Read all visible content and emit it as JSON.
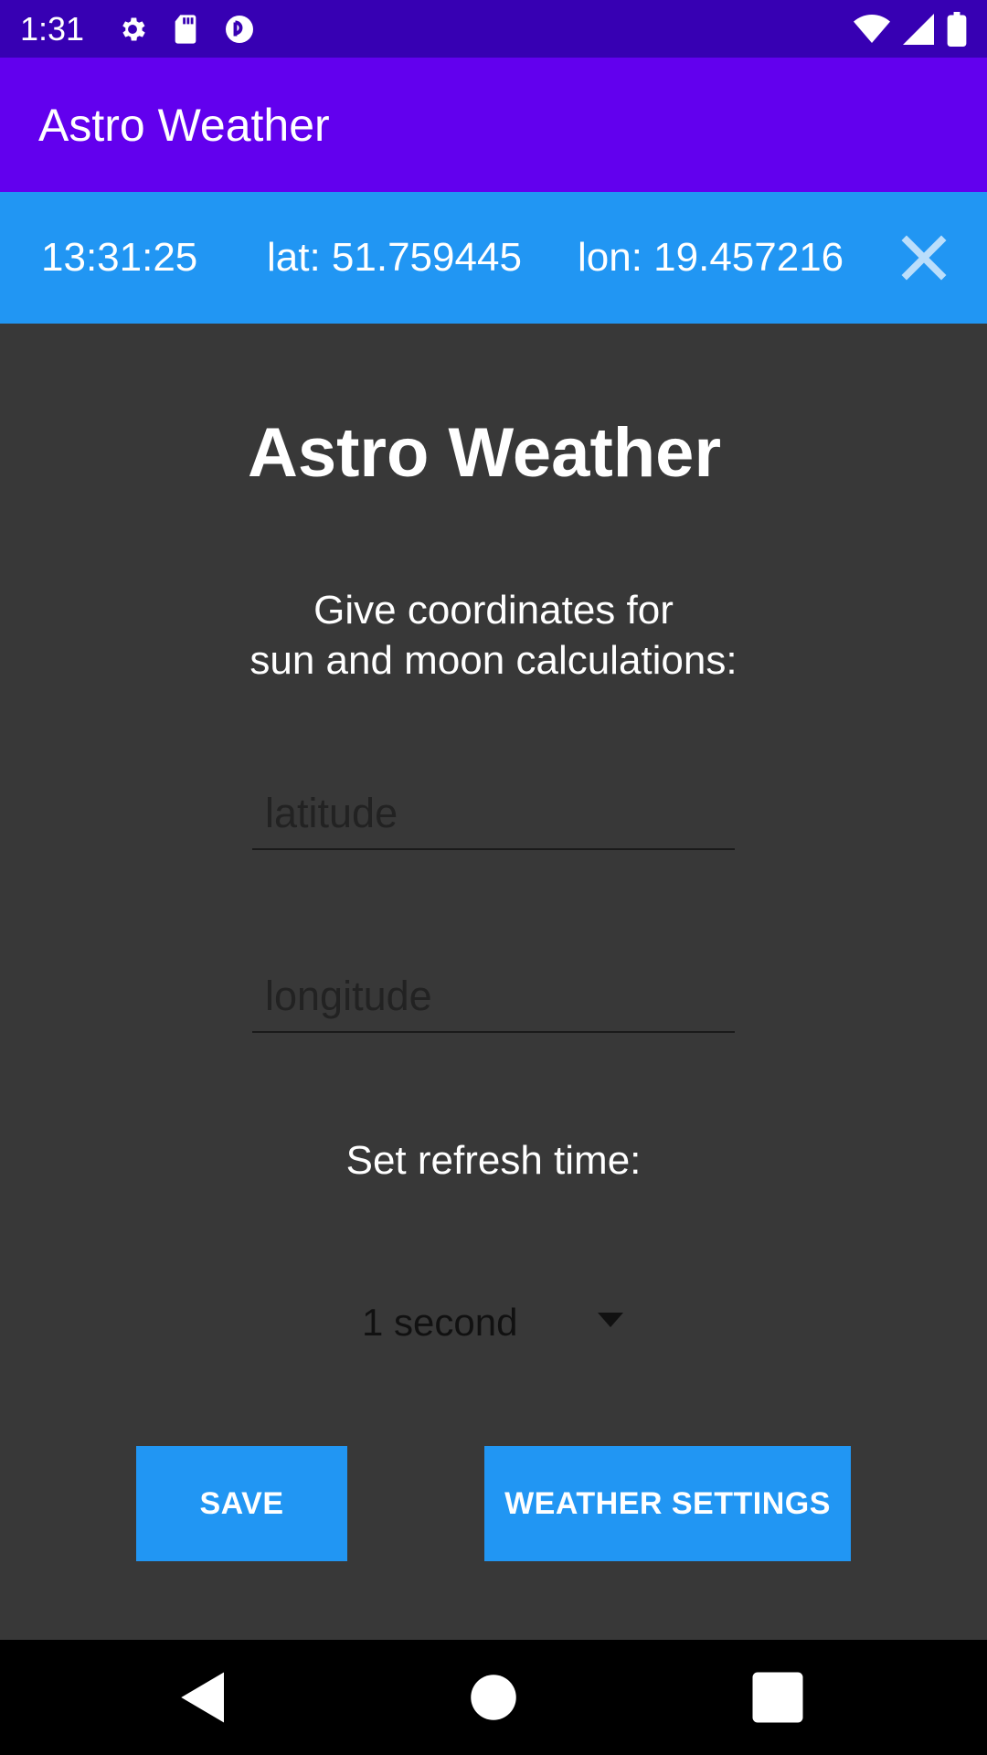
{
  "status_bar": {
    "time": "1:31",
    "icons_left": [
      "settings-icon",
      "sd-card-icon",
      "app-notification-icon"
    ],
    "icons_right": [
      "wifi-icon",
      "signal-icon",
      "battery-icon"
    ]
  },
  "app_bar": {
    "title": "Astro Weather"
  },
  "info_strip": {
    "time": "13:31:25",
    "lat": "lat: 51.759445",
    "lon": "lon: 19.457216",
    "close_icon": "close-icon"
  },
  "main": {
    "title": "Astro Weather",
    "subtitle_line1": "Give coordinates for",
    "subtitle_line2": "sun and moon calculations:",
    "latitude": {
      "value": "",
      "placeholder": "latitude"
    },
    "longitude": {
      "value": "",
      "placeholder": "longitude"
    },
    "refresh_label": "Set refresh time:",
    "refresh_selected": "1 second",
    "save_label": "SAVE",
    "weather_settings_label": "WEATHER SETTINGS"
  },
  "nav_bar": {
    "back": "back-icon",
    "home": "home-icon",
    "recents": "recents-icon"
  },
  "colors": {
    "status_bar": "#3700b3",
    "app_bar": "#6200ee",
    "accent": "#2196f3",
    "background": "#383838"
  }
}
